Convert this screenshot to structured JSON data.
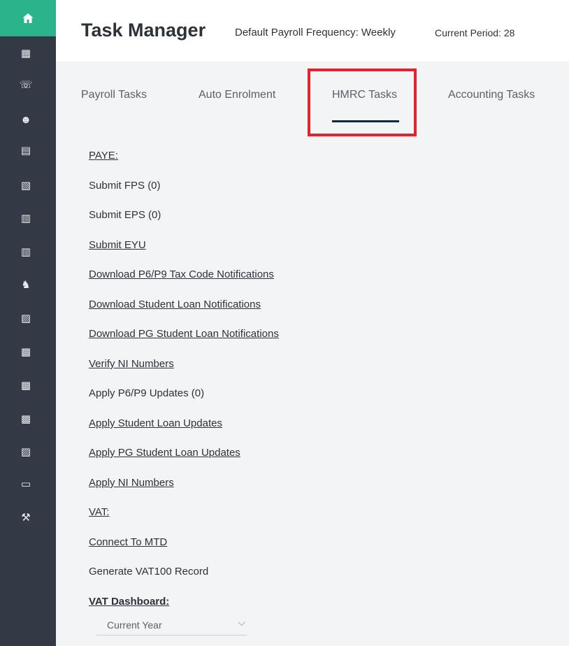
{
  "header": {
    "title": "Task Manager",
    "payroll_frequency": "Default Payroll Frequency: Weekly",
    "current_period": "Current Period: 28"
  },
  "tabs": [
    {
      "label": "Payroll Tasks",
      "active": false
    },
    {
      "label": "Auto Enrolment",
      "active": false
    },
    {
      "label": "HMRC Tasks",
      "active": true
    },
    {
      "label": "Accounting Tasks",
      "active": false
    }
  ],
  "tasks": [
    {
      "label": "PAYE:",
      "link": true
    },
    {
      "label": "Submit FPS (0)",
      "link": false
    },
    {
      "label": "Submit EPS (0)",
      "link": false
    },
    {
      "label": "Submit EYU",
      "link": true
    },
    {
      "label": "Download P6/P9 Tax Code Notifications",
      "link": true
    },
    {
      "label": "Download Student Loan Notifications",
      "link": true
    },
    {
      "label": "Download PG Student Loan Notifications",
      "link": true
    },
    {
      "label": "Verify NI Numbers",
      "link": true
    },
    {
      "label": "Apply P6/P9 Updates (0)",
      "link": false
    },
    {
      "label": "Apply Student Loan Updates",
      "link": true
    },
    {
      "label": "Apply PG Student Loan Updates",
      "link": true
    },
    {
      "label": "Apply NI Numbers",
      "link": true
    },
    {
      "label": "VAT:",
      "link": true
    },
    {
      "label": "Connect To MTD",
      "link": true
    },
    {
      "label": "Generate VAT100 Record",
      "link": false
    },
    {
      "label": "VAT Dashboard:",
      "link": true
    }
  ],
  "dashboard_select": {
    "value": "Current Year"
  },
  "sidebar": {
    "icons": [
      {
        "name": "home-icon",
        "glyph": "⌂"
      },
      {
        "name": "building-icon",
        "glyph": "▦"
      },
      {
        "name": "support-icon",
        "glyph": "☏"
      },
      {
        "name": "users-icon",
        "glyph": "☻"
      },
      {
        "name": "clipboard-icon",
        "glyph": "▤"
      },
      {
        "name": "settings-doc-icon",
        "glyph": "▧"
      },
      {
        "name": "document-icon",
        "glyph": "▥"
      },
      {
        "name": "report-icon",
        "glyph": "▥"
      },
      {
        "name": "people-desk-icon",
        "glyph": "♞"
      },
      {
        "name": "money-doc-icon",
        "glyph": "▨"
      },
      {
        "name": "file-pay-icon",
        "glyph": "▩"
      },
      {
        "name": "file-pay-icon-2",
        "glyph": "▩"
      },
      {
        "name": "file-pay-icon-3",
        "glyph": "▩"
      },
      {
        "name": "file-box-icon",
        "glyph": "▨"
      },
      {
        "name": "folder-icon",
        "glyph": "▭"
      },
      {
        "name": "tools-icon",
        "glyph": "⚒"
      }
    ]
  },
  "colors": {
    "sidebar": "#333a45",
    "home_accent": "#2bb38c",
    "highlight": "#e5222b",
    "active_underline": "#0f2a36"
  }
}
